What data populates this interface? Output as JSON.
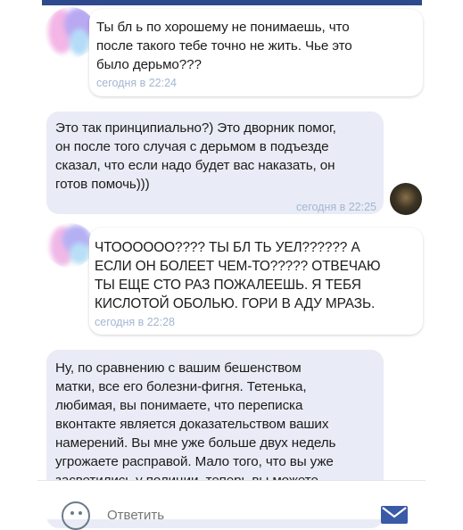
{
  "messages": [
    {
      "direction": "incoming",
      "text": "Ты бл  ь по хорошему не понимаешь, что\nпосле такого тебе точно не жить. Чье это\nбыло дерьмо???",
      "time": "сегодня в 22:24"
    },
    {
      "direction": "outgoing",
      "text": "Это так принципиально?) Это дворник помог,\nон после того случая с дерьмом в подъезде\nсказал, что если надо будет вас наказать, он\nготов помочь)))",
      "time": "сегодня в 22:25"
    },
    {
      "direction": "incoming",
      "text": "ЧТОООООО???? ТЫ БЛ  ТЬ   УЕЛ?????? А\nЕСЛИ ОН БОЛЕЕТ ЧЕМ-ТО????? ОТВЕЧАЮ\nТЫ ЕЩЕ СТО РАЗ ПОЖАЛЕЕШЬ. Я ТЕБЯ\nКИСЛОТОЙ ОБОЛЬЮ. ГОРИ В АДУ МРАЗЬ.",
      "time": "сегодня в 22:28"
    },
    {
      "direction": "outgoing",
      "text": "Ну, по сравнению с вашим бешенством\nматки, все его болезни-фигня. Тетенька,\nлюбимая, вы понимаете, что переписка\nвконтакте является доказательством ваших\nнамерений. Вы мне уже больше двух недель\nугрожаете расправой. Мало того, что вы уже\nзасветились у полиции, теперь вы можете"
    }
  ],
  "composer": {
    "placeholder": "Ответить"
  },
  "icons": {
    "emoji": "emoji-smile-icon",
    "send": "send-envelope-icon"
  },
  "colors": {
    "header": "#2f4a8c",
    "outgoing_bubble": "#e9ecf6",
    "timestamp": "#a4b6d1",
    "send": "#3a5aa8"
  }
}
